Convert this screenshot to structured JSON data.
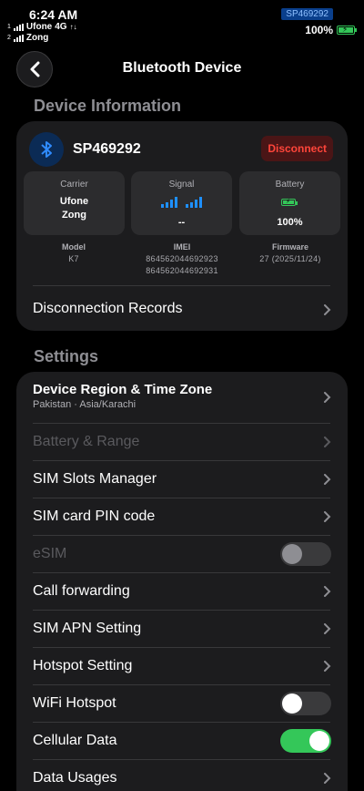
{
  "status_bar": {
    "time": "6:24 AM",
    "sim1": {
      "index": "1",
      "carrier": "Ufone",
      "network": "4G"
    },
    "sim2": {
      "index": "2",
      "carrier": "Zong"
    },
    "device_badge": "SP469292",
    "battery": "100%",
    "battery_level": 1.0
  },
  "nav": {
    "title": "Bluetooth Device",
    "back_icon": "chevron-left-icon"
  },
  "device_info": {
    "section_title": "Device Information",
    "name": "SP469292",
    "disconnect_label": "Disconnect",
    "carrier": {
      "label": "Carrier",
      "lines": [
        "Ufone",
        "Zong"
      ]
    },
    "signal": {
      "label": "Signal",
      "value": "--"
    },
    "battery": {
      "label": "Battery",
      "value": "100%"
    },
    "model": {
      "label": "Model",
      "value": "K7"
    },
    "imei": {
      "label": "IMEI",
      "values": [
        "864562044692923",
        "864562044692931"
      ]
    },
    "firmware": {
      "label": "Firmware",
      "value": "27 (2025/11/24)"
    },
    "disconnection_records": "Disconnection Records"
  },
  "settings": {
    "section_title": "Settings",
    "items": [
      {
        "label": "Device Region & Time Zone",
        "sub": "Pakistan · Asia/Karachi",
        "control": "chevron",
        "enabled": true
      },
      {
        "label": "Battery & Range",
        "control": "chevron",
        "enabled": false
      },
      {
        "label": "SIM Slots Manager",
        "control": "chevron",
        "enabled": true
      },
      {
        "label": "SIM card PIN code",
        "control": "chevron",
        "enabled": true
      },
      {
        "label": "eSIM",
        "control": "toggle",
        "on": false,
        "enabled": false
      },
      {
        "label": "Call forwarding",
        "control": "chevron",
        "enabled": true
      },
      {
        "label": "SIM APN Setting",
        "control": "chevron",
        "enabled": true
      },
      {
        "label": "Hotspot Setting",
        "control": "chevron",
        "enabled": true
      },
      {
        "label": "WiFi Hotspot",
        "control": "toggle",
        "on": false,
        "enabled": true
      },
      {
        "label": "Cellular Data",
        "control": "toggle",
        "on": true,
        "enabled": true
      },
      {
        "label": "Data Usages",
        "control": "chevron",
        "enabled": true
      }
    ]
  },
  "colors": {
    "accent_blue": "#1e90ff",
    "destructive_red": "#ff453a",
    "toggle_on_green": "#34c759",
    "disabled_text": "#5a5a5e"
  }
}
